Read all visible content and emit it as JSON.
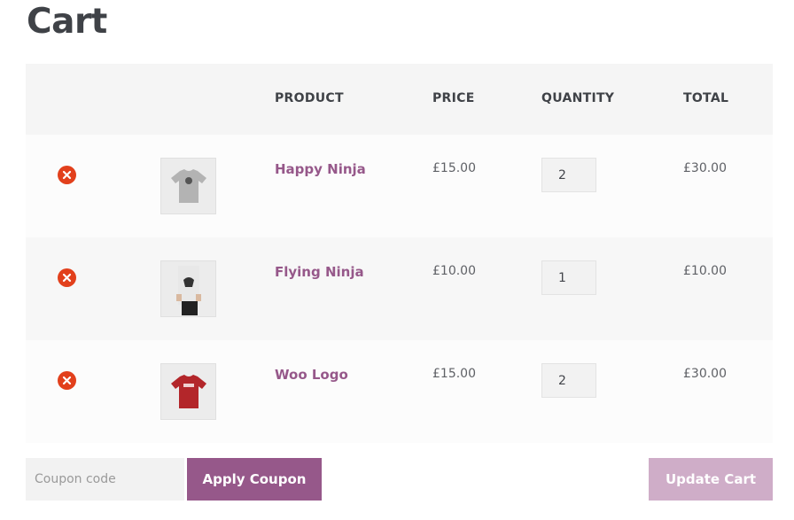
{
  "page": {
    "title": "Cart"
  },
  "table": {
    "headers": {
      "product": "PRODUCT",
      "price": "PRICE",
      "quantity": "QUANTITY",
      "total": "TOTAL"
    },
    "rows": [
      {
        "name": "Happy Ninja",
        "price": "£15.00",
        "quantity": "2",
        "total": "£30.00",
        "thumb": "grey-tshirt"
      },
      {
        "name": "Flying Ninja",
        "price": "£10.00",
        "quantity": "1",
        "total": "£10.00",
        "thumb": "poster"
      },
      {
        "name": "Woo Logo",
        "price": "£15.00",
        "quantity": "2",
        "total": "£30.00",
        "thumb": "red-tshirt"
      }
    ]
  },
  "actions": {
    "coupon_placeholder": "Coupon code",
    "apply_label": "Apply Coupon",
    "update_label": "Update Cart"
  },
  "colors": {
    "accent": "#96588a",
    "accent_disabled": "#cfadc8",
    "remove": "#e2401c"
  },
  "icons": {
    "remove": "remove-circle-icon"
  }
}
